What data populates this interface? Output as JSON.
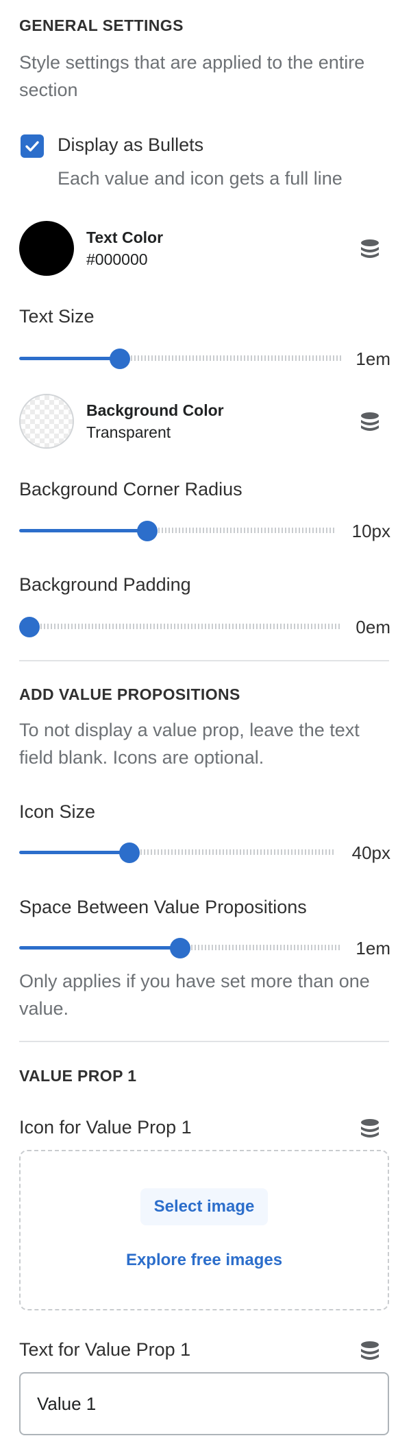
{
  "general": {
    "heading": "GENERAL SETTINGS",
    "description": "Style settings that are applied to the entire section",
    "bullets": {
      "label": "Display as Bullets",
      "help": "Each value and icon gets a full line",
      "checked": true
    },
    "text_color": {
      "name": "Text Color",
      "value": "#000000",
      "icon": "database-icon"
    },
    "text_size": {
      "label": "Text Size",
      "value_text": "1em",
      "fraction": 0.3
    },
    "background_color": {
      "name": "Background Color",
      "value": "Transparent",
      "icon": "database-icon"
    },
    "corner_radius": {
      "label": "Background Corner Radius",
      "value_text": "10px",
      "fraction": 0.4
    },
    "padding": {
      "label": "Background Padding",
      "value_text": "0em",
      "fraction": 0.0
    }
  },
  "value_props": {
    "heading": "ADD VALUE PROPOSITIONS",
    "description": "To not display a value prop, leave the text field blank. Icons are optional.",
    "icon_size": {
      "label": "Icon Size",
      "value_text": "40px",
      "fraction": 0.34
    },
    "spacing": {
      "label": "Space Between Value Propositions",
      "value_text": "1em",
      "fraction": 0.5,
      "help": "Only applies if you have set more than one value."
    }
  },
  "prop1": {
    "heading": "VALUE PROP 1",
    "icon_label": "Icon for Value Prop 1",
    "select_image": "Select image",
    "explore_images": "Explore free images",
    "text_label": "Text for Value Prop 1",
    "text_value": "Value 1"
  },
  "colors": {
    "accent": "#2c6ecb",
    "text": "#303030",
    "subdued": "#6d7175",
    "divider": "#e1e3e5"
  }
}
